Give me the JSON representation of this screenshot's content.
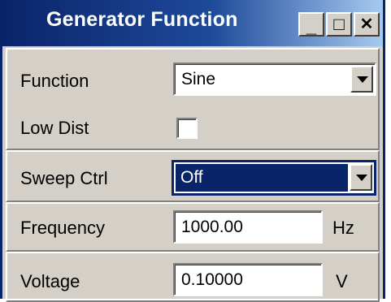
{
  "window": {
    "title": "Generator Function",
    "controls": {
      "minimize": "_",
      "maximize": "□",
      "close": "✕"
    }
  },
  "rows": {
    "function": {
      "label": "Function",
      "value": "Sine"
    },
    "low_dist": {
      "label": "Low Dist",
      "checked": false
    },
    "sweep_ctrl": {
      "label": "Sweep Ctrl",
      "value": "Off"
    },
    "frequency": {
      "label": "Frequency",
      "value": "1000.00",
      "unit": "Hz"
    },
    "voltage": {
      "label": "Voltage",
      "value": "0.10000",
      "unit": "V"
    }
  },
  "colors": {
    "title_bar": "#0a246a",
    "panel": "#d4d0c8",
    "selection": "#0a246a"
  }
}
